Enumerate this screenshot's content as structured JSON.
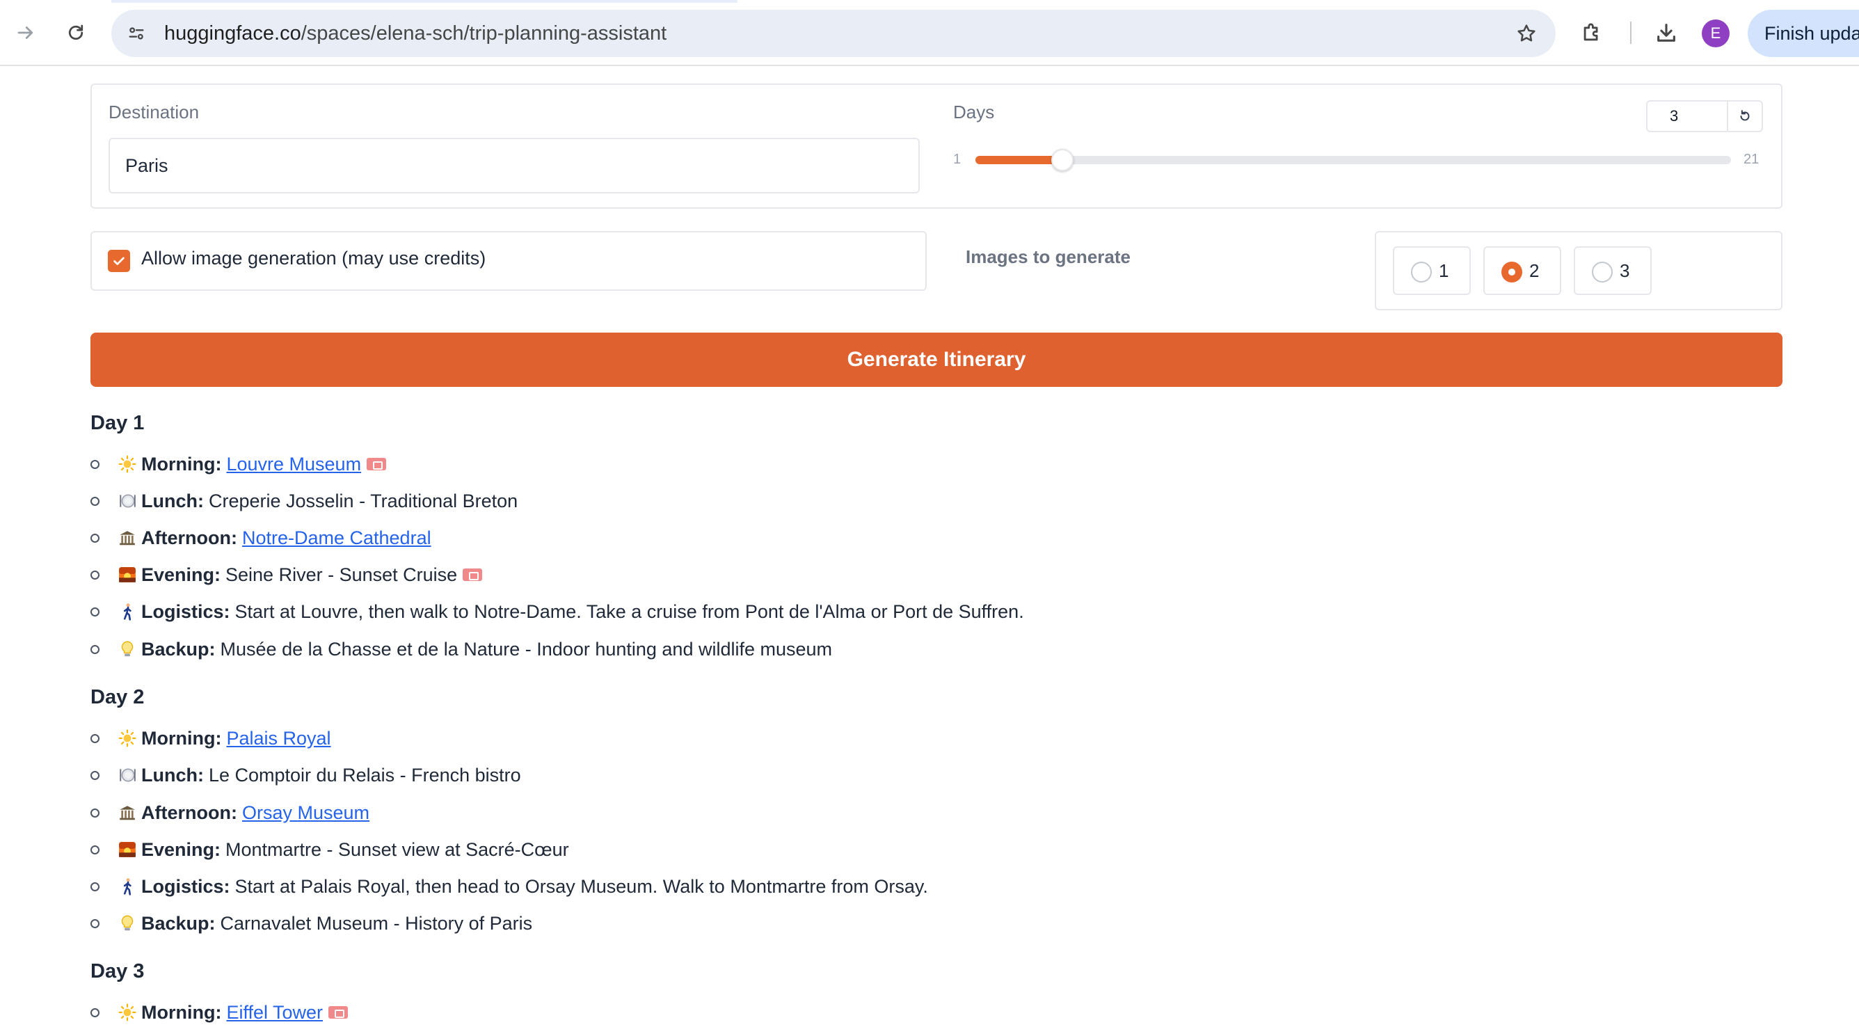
{
  "browser": {
    "url_host": "huggingface.co",
    "url_path": "/spaces/elena-sch/trip-planning-assistant",
    "avatar_letter": "E",
    "finish_update_label": "Finish upda"
  },
  "form": {
    "destination_label": "Destination",
    "destination_value": "Paris",
    "days_label": "Days",
    "days_value": "3",
    "days_min": "1",
    "days_max": "21",
    "days_fraction": 0.1,
    "allow_images_label": "Allow image generation (may use credits)",
    "allow_images_checked": true,
    "images_label": "Images to generate",
    "image_options": [
      "1",
      "2",
      "3"
    ],
    "image_selected": "2",
    "generate_label": "Generate Itinerary"
  },
  "itinerary": [
    {
      "day": "Day 1",
      "items": [
        {
          "icon": "sun-icon",
          "label": "Morning:",
          "link": "Louvre Museum",
          "ticket": true
        },
        {
          "icon": "plate-icon",
          "label": "Lunch:",
          "text": "Creperie Josselin - Traditional Breton"
        },
        {
          "icon": "museum-icon",
          "label": "Afternoon:",
          "link": "Notre-Dame Cathedral"
        },
        {
          "icon": "sunset-icon",
          "label": "Evening:",
          "text": "Seine River - Sunset Cruise",
          "ticket": true
        },
        {
          "icon": "walking-icon",
          "label": "Logistics:",
          "text": "Start at Louvre, then walk to Notre-Dame. Take a cruise from Pont de l'Alma or Port de Suffren."
        },
        {
          "icon": "bulb-icon",
          "label": "Backup:",
          "text": "Musée de la Chasse et de la Nature - Indoor hunting and wildlife museum"
        }
      ]
    },
    {
      "day": "Day 2",
      "items": [
        {
          "icon": "sun-icon",
          "label": "Morning:",
          "link": "Palais Royal"
        },
        {
          "icon": "plate-icon",
          "label": "Lunch:",
          "text": "Le Comptoir du Relais - French bistro"
        },
        {
          "icon": "museum-icon",
          "label": "Afternoon:",
          "link": "Orsay Museum"
        },
        {
          "icon": "sunset-icon",
          "label": "Evening:",
          "text": "Montmartre - Sunset view at Sacré-Cœur"
        },
        {
          "icon": "walking-icon",
          "label": "Logistics:",
          "text": "Start at Palais Royal, then head to Orsay Museum. Walk to Montmartre from Orsay."
        },
        {
          "icon": "bulb-icon",
          "label": "Backup:",
          "text": "Carnavalet Museum - History of Paris"
        }
      ]
    },
    {
      "day": "Day 3",
      "items": [
        {
          "icon": "sun-icon",
          "label": "Morning:",
          "link": "Eiffel Tower",
          "ticket": true
        }
      ]
    }
  ]
}
